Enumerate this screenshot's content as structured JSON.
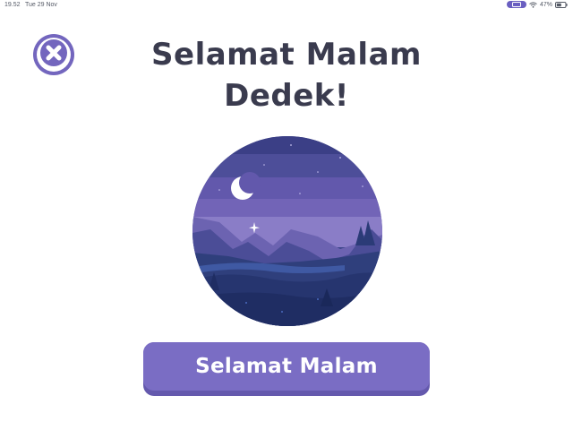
{
  "status_bar": {
    "time": "19.52",
    "date": "Tue 29 Nov",
    "battery": "47%",
    "icons": [
      "screen-mirroring-icon",
      "wifi-icon",
      "battery-icon"
    ]
  },
  "close_button": {
    "icon": "close-icon"
  },
  "title": {
    "line1": "Selamat Malam",
    "line2": "Dedek!"
  },
  "illustration": {
    "subject": "night landscape with crescent moon"
  },
  "primary_button": {
    "label": "Selamat Malam"
  },
  "colors": {
    "accent": "#7a6dc4",
    "accent_dark": "#6459ad",
    "title_text": "#3a3b4e",
    "background": "#ffffff"
  }
}
